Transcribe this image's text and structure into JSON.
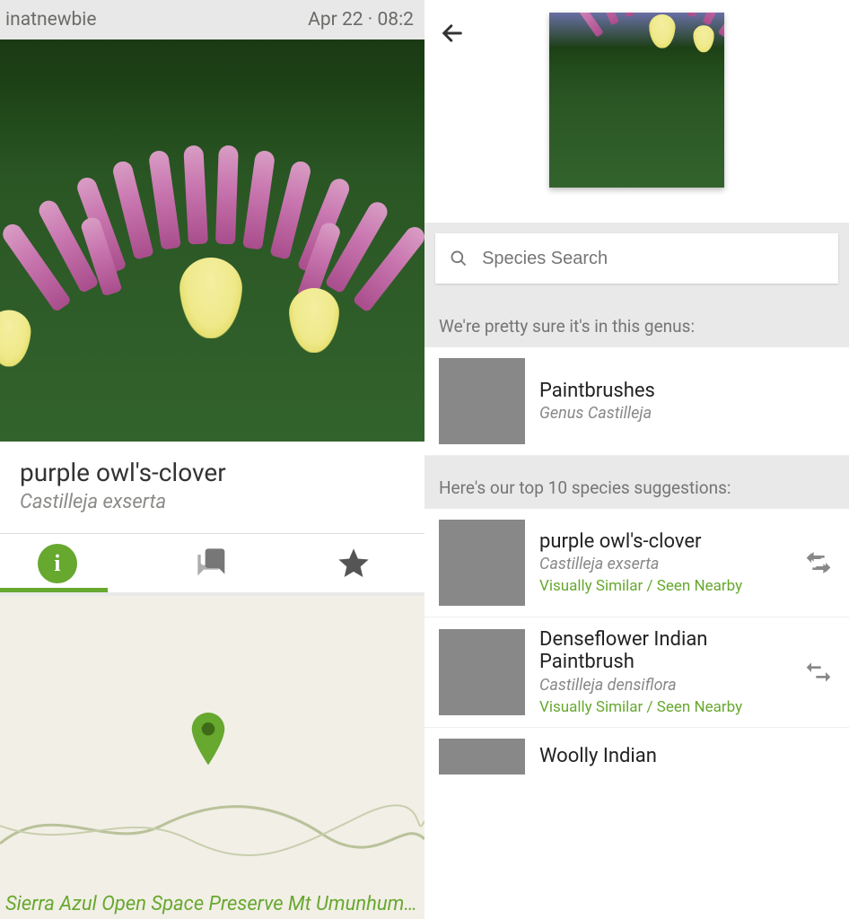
{
  "left": {
    "username": "inatnewbie",
    "datetime": "Apr 22 · 08:2",
    "common_name": "purple owl's-clover",
    "scientific_name": "Castilleja exserta",
    "map_label": "Sierra Azul Open Space Preserve Mt Umunhum…"
  },
  "right": {
    "search_placeholder": "Species Search",
    "genus_heading": "We're pretty sure it's in this genus:",
    "genus": {
      "common": "Paintbrushes",
      "sci": "Genus Castilleja"
    },
    "top_heading": "Here's our top 10 species suggestions:",
    "suggestions": [
      {
        "common": "purple owl's-clover",
        "sci": "Castilleja exserta",
        "reason": "Visually Similar / Seen Nearby"
      },
      {
        "common": "Denseflower Indian Paintbrush",
        "sci": "Castilleja densiflora",
        "reason": "Visually Similar / Seen Nearby"
      },
      {
        "common": "Woolly Indian",
        "sci": "",
        "reason": ""
      }
    ]
  }
}
